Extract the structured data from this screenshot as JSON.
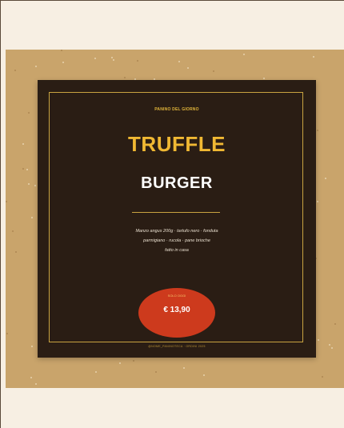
{
  "poster": {
    "kicker": "PANINO DEL GIORNO",
    "title_line1": "TRUFFLE",
    "title_line2": "BURGER",
    "description_lines": [
      "Manzo angus 200g · tartufo nero · fonduta",
      "parmigiano · rucola · pane brioche",
      "fatto in casa"
    ],
    "price_kicker": "SOLO OGGI",
    "price": "€ 13,90",
    "footer_handle": "@NOME_PANINOTECA · ORDINI 2025"
  },
  "colors": {
    "page_bg": "#f7efe3",
    "stage_bg": "#c9a46b",
    "card_bg": "#2a1d14",
    "gold": "#c9a441",
    "title_gold": "#f0b833",
    "price_red": "#cd3a1d"
  }
}
